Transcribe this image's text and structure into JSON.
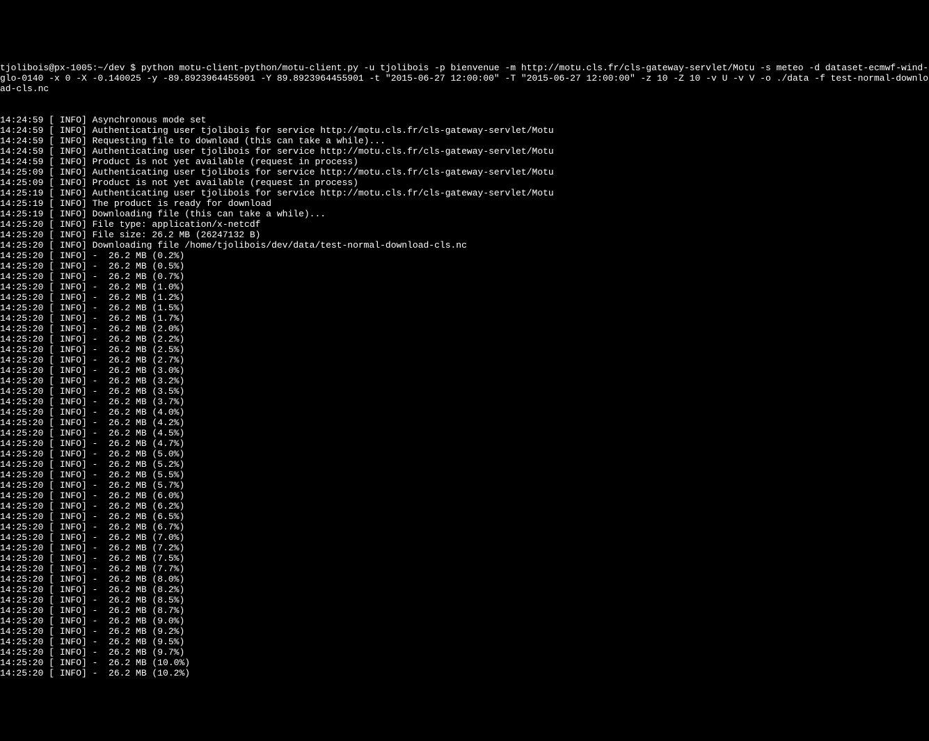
{
  "terminal": {
    "prompt_line": "tjolibois@px-1005:~/dev $ python motu-client-python/motu-client.py -u tjolibois -p bienvenue -m http://motu.cls.fr/cls-gateway-servlet/Motu -s meteo -d dataset-ecmwf-wind-glo-0140 -x 0 -X -0.140025 -y -89.8923964455901 -Y 89.8923964455901 -t \"2015-06-27 12:00:00\" -T \"2015-06-27 12:00:00\" -z 10 -Z 10 -v U -v V -o ./data -f test-normal-download-cls.nc",
    "log_lines": [
      "14:24:59 [ INFO] Asynchronous mode set",
      "14:24:59 [ INFO] Authenticating user tjolibois for service http://motu.cls.fr/cls-gateway-servlet/Motu",
      "14:24:59 [ INFO] Requesting file to download (this can take a while)...",
      "14:24:59 [ INFO] Authenticating user tjolibois for service http://motu.cls.fr/cls-gateway-servlet/Motu",
      "14:24:59 [ INFO] Product is not yet available (request in process)",
      "14:25:09 [ INFO] Authenticating user tjolibois for service http://motu.cls.fr/cls-gateway-servlet/Motu",
      "14:25:09 [ INFO] Product is not yet available (request in process)",
      "14:25:19 [ INFO] Authenticating user tjolibois for service http://motu.cls.fr/cls-gateway-servlet/Motu",
      "14:25:19 [ INFO] The product is ready for download",
      "14:25:19 [ INFO] Downloading file (this can take a while)...",
      "14:25:20 [ INFO] File type: application/x-netcdf",
      "14:25:20 [ INFO] File size: 26.2 MB (26247132 B)",
      "14:25:20 [ INFO] Downloading file /home/tjolibois/dev/data/test-normal-download-cls.nc",
      "14:25:20 [ INFO] -  26.2 MB (0.2%)",
      "14:25:20 [ INFO] -  26.2 MB (0.5%)",
      "14:25:20 [ INFO] -  26.2 MB (0.7%)",
      "14:25:20 [ INFO] -  26.2 MB (1.0%)",
      "14:25:20 [ INFO] -  26.2 MB (1.2%)",
      "14:25:20 [ INFO] -  26.2 MB (1.5%)",
      "14:25:20 [ INFO] -  26.2 MB (1.7%)",
      "14:25:20 [ INFO] -  26.2 MB (2.0%)",
      "14:25:20 [ INFO] -  26.2 MB (2.2%)",
      "14:25:20 [ INFO] -  26.2 MB (2.5%)",
      "14:25:20 [ INFO] -  26.2 MB (2.7%)",
      "14:25:20 [ INFO] -  26.2 MB (3.0%)",
      "14:25:20 [ INFO] -  26.2 MB (3.2%)",
      "14:25:20 [ INFO] -  26.2 MB (3.5%)",
      "14:25:20 [ INFO] -  26.2 MB (3.7%)",
      "14:25:20 [ INFO] -  26.2 MB (4.0%)",
      "14:25:20 [ INFO] -  26.2 MB (4.2%)",
      "14:25:20 [ INFO] -  26.2 MB (4.5%)",
      "14:25:20 [ INFO] -  26.2 MB (4.7%)",
      "14:25:20 [ INFO] -  26.2 MB (5.0%)",
      "14:25:20 [ INFO] -  26.2 MB (5.2%)",
      "14:25:20 [ INFO] -  26.2 MB (5.5%)",
      "14:25:20 [ INFO] -  26.2 MB (5.7%)",
      "14:25:20 [ INFO] -  26.2 MB (6.0%)",
      "14:25:20 [ INFO] -  26.2 MB (6.2%)",
      "14:25:20 [ INFO] -  26.2 MB (6.5%)",
      "14:25:20 [ INFO] -  26.2 MB (6.7%)",
      "14:25:20 [ INFO] -  26.2 MB (7.0%)",
      "14:25:20 [ INFO] -  26.2 MB (7.2%)",
      "14:25:20 [ INFO] -  26.2 MB (7.5%)",
      "14:25:20 [ INFO] -  26.2 MB (7.7%)",
      "14:25:20 [ INFO] -  26.2 MB (8.0%)",
      "14:25:20 [ INFO] -  26.2 MB (8.2%)",
      "14:25:20 [ INFO] -  26.2 MB (8.5%)",
      "14:25:20 [ INFO] -  26.2 MB (8.7%)",
      "14:25:20 [ INFO] -  26.2 MB (9.0%)",
      "14:25:20 [ INFO] -  26.2 MB (9.2%)",
      "14:25:20 [ INFO] -  26.2 MB (9.5%)",
      "14:25:20 [ INFO] -  26.2 MB (9.7%)",
      "14:25:20 [ INFO] -  26.2 MB (10.0%)",
      "14:25:20 [ INFO] -  26.2 MB (10.2%)"
    ]
  }
}
